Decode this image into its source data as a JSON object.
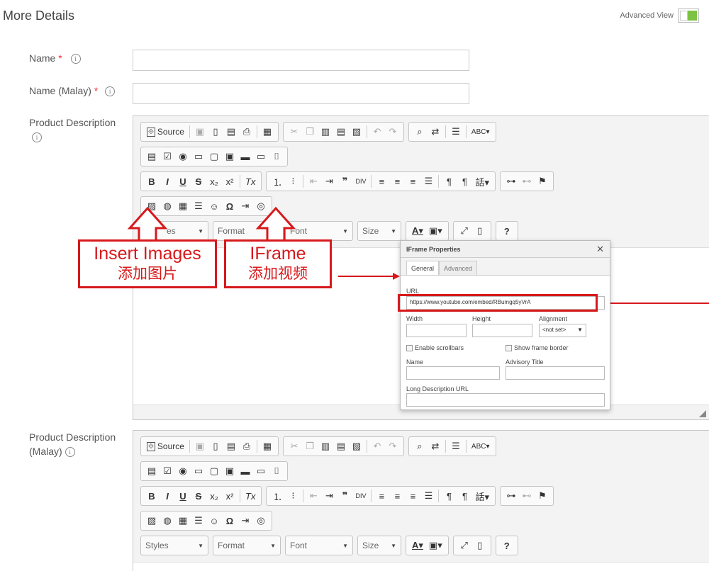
{
  "header": {
    "title": "More Details",
    "advanced_view_label": "Advanced View"
  },
  "fields": {
    "name_label": "Name",
    "name_malay_label": "Name (Malay)",
    "required_mark": "*",
    "info_glyph": "i",
    "product_desc_label": "Product Description",
    "product_desc_malay_label_1": "Product Description",
    "product_desc_malay_label_2": "(Malay)"
  },
  "toolbar": {
    "source_label": "Source",
    "styles_label": "Styles",
    "styles_partial": "es",
    "format_label": "Format",
    "font_label": "Font",
    "size_label": "Size",
    "help_label": "?"
  },
  "callouts": {
    "insert_images_en": "Insert Images",
    "insert_images_zh": "添加图片",
    "iframe_en": "IFrame",
    "iframe_zh": "添加视频"
  },
  "dialog": {
    "title": "IFrame Properties",
    "close": "✕",
    "tab_general": "General",
    "tab_advanced": "Advanced",
    "url_label": "URL",
    "url_value": "https://www.youtube.com/embed/RBumgq5yVrA",
    "width_label": "Width",
    "height_label": "Height",
    "alignment_label": "Alignment",
    "alignment_value": "<not set>",
    "enable_scrollbars": "Enable scrollbars",
    "show_frame_border": "Show frame border",
    "name_label": "Name",
    "advisory_title_label": "Advisory Title",
    "long_desc_label": "Long Description URL"
  },
  "colors": {
    "accent_green": "#7cc243",
    "annotation_red": "#d7191c"
  }
}
